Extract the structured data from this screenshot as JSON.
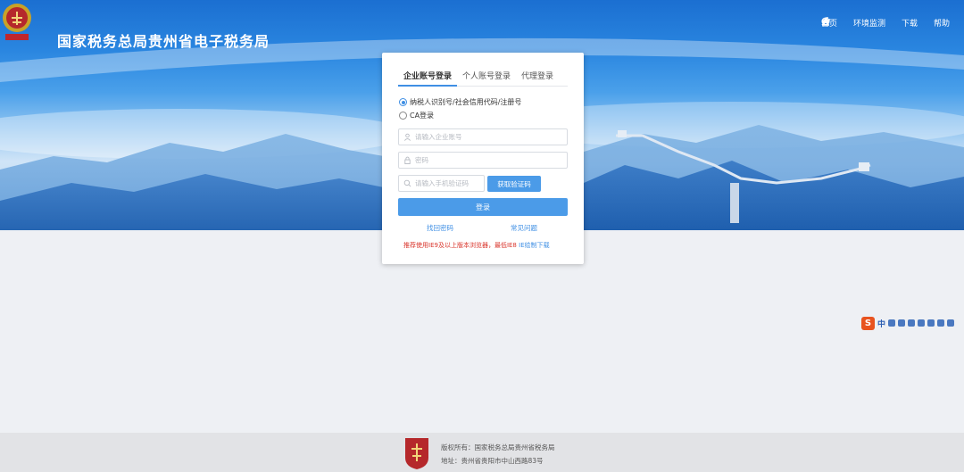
{
  "header": {
    "site_title": "国家税务总局贵州省电子税务局",
    "nav": [
      {
        "label": "首页",
        "icon": "home-icon"
      },
      {
        "label": "环境监测",
        "icon": "wrench-icon"
      },
      {
        "label": "下载",
        "icon": "download-icon"
      },
      {
        "label": "帮助",
        "icon": "info-icon"
      }
    ]
  },
  "login": {
    "tabs": [
      "企业账号登录",
      "个人账号登录",
      "代理登录"
    ],
    "active_tab": 0,
    "radio_options": [
      "纳税人识别号/社会信用代码/注册号",
      "CA登录"
    ],
    "selected_radio": 0,
    "account_placeholder": "请输入企业账号",
    "password_placeholder": "密码",
    "sms_placeholder": "请输入手机验证码",
    "sms_button": "获取验证码",
    "login_button": "登录",
    "forgot_password": "找回密码",
    "faq": "常见问题",
    "notice": "推荐使用IE9及以上版本浏览器，最低IE8",
    "notice_link": "IE绘制下载"
  },
  "ime_toolbar": {
    "lang": "中"
  },
  "footer": {
    "copyright": "版权所有：国家税务总局贵州省税务局",
    "address": "地址：贵州省贵阳市中山西路83号"
  },
  "colors": {
    "accent": "#4b9be8",
    "notice": "#d9342b",
    "banner_top": "#1b6fd1"
  }
}
